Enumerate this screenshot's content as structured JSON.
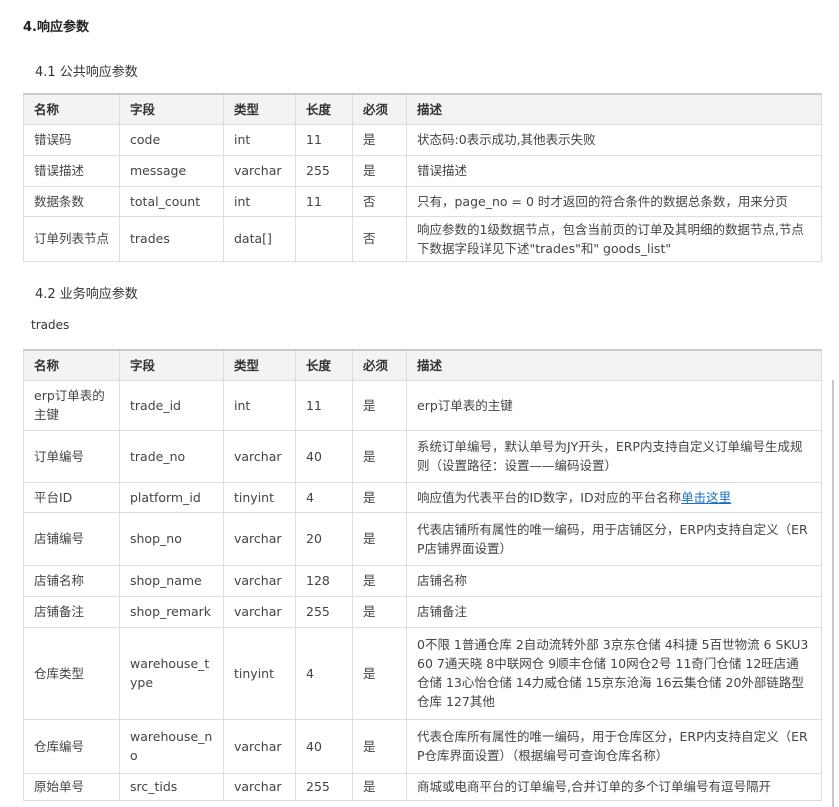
{
  "section_title": "4.响应参数",
  "public_title": "4.1 公共响应参数",
  "business_title": "4.2 业务响应参数",
  "trades_label": "trades",
  "headers": [
    "名称",
    "字段",
    "类型",
    "长度",
    "必须",
    "描述"
  ],
  "public_rows": [
    [
      "错误码",
      "code",
      "int",
      "11",
      "是",
      "状态码:0表示成功,其他表示失败"
    ],
    [
      "错误描述",
      "message",
      "varchar",
      "255",
      "是",
      "错误描述"
    ],
    [
      "数据条数",
      "total_count",
      "int",
      "11",
      "否",
      "只有，page_no = 0 时才返回的符合条件的数据总条数，用来分页"
    ],
    [
      "订单列表节点",
      "trades",
      "data[]",
      "",
      "否",
      "响应参数的1级数据节点，包含当前页的订单及其明细的数据节点,节点下数据字段详见下述\"trades\"和\" goods_list\""
    ]
  ],
  "trades_rows": [
    [
      "erp订单表的主键",
      "trade_id",
      "int",
      "11",
      "是",
      "erp订单表的主键"
    ],
    [
      "订单编号",
      "trade_no",
      "varchar",
      "40",
      "是",
      "系统订单编号，默认单号为JY开头，ERP内支持自定义订单编号生成规则（设置路径：设置——编码设置）"
    ],
    [
      "平台ID",
      "platform_id",
      "tinyint",
      "4",
      "是",
      "响应值为代表平台的ID数字，ID对应的平台名称"
    ],
    [
      "店铺编号",
      "shop_no",
      "varchar",
      "20",
      "是",
      "代表店铺所有属性的唯一编码，用于店铺区分，ERP内支持自定义（ERP店铺界面设置）"
    ],
    [
      "店铺名称",
      "shop_name",
      "varchar",
      "128",
      "是",
      "店铺名称"
    ],
    [
      "店铺备注",
      "shop_remark",
      "varchar",
      "255",
      "是",
      "店铺备注"
    ],
    [
      "仓库类型",
      "warehouse_type",
      "tinyint",
      "4",
      "是",
      "0不限 1普通仓库 2自动流转外部 3京东仓储 4科捷 5百世物流 6 SKU360 7通天晓 8中联网仓 9顺丰仓储 10网仓2号 11奇门仓储 12旺店通仓储 13心怡仓储 14力威仓储 15京东沧海 16云集仓储  20外部链路型仓库 127其他"
    ],
    [
      "仓库编号",
      "warehouse_no",
      "varchar",
      "40",
      "是",
      "代表仓库所有属性的唯一编码，用于仓库区分，ERP内支持自定义（ERP仓库界面设置）（根据编号可查询仓库名称）"
    ],
    [
      "原始单号",
      "src_tids",
      "varchar",
      "255",
      "是",
      "商城或电商平台的订单编号,合并订单的多个订单编号有逗号隔开"
    ]
  ],
  "platform_link": "单击这里"
}
